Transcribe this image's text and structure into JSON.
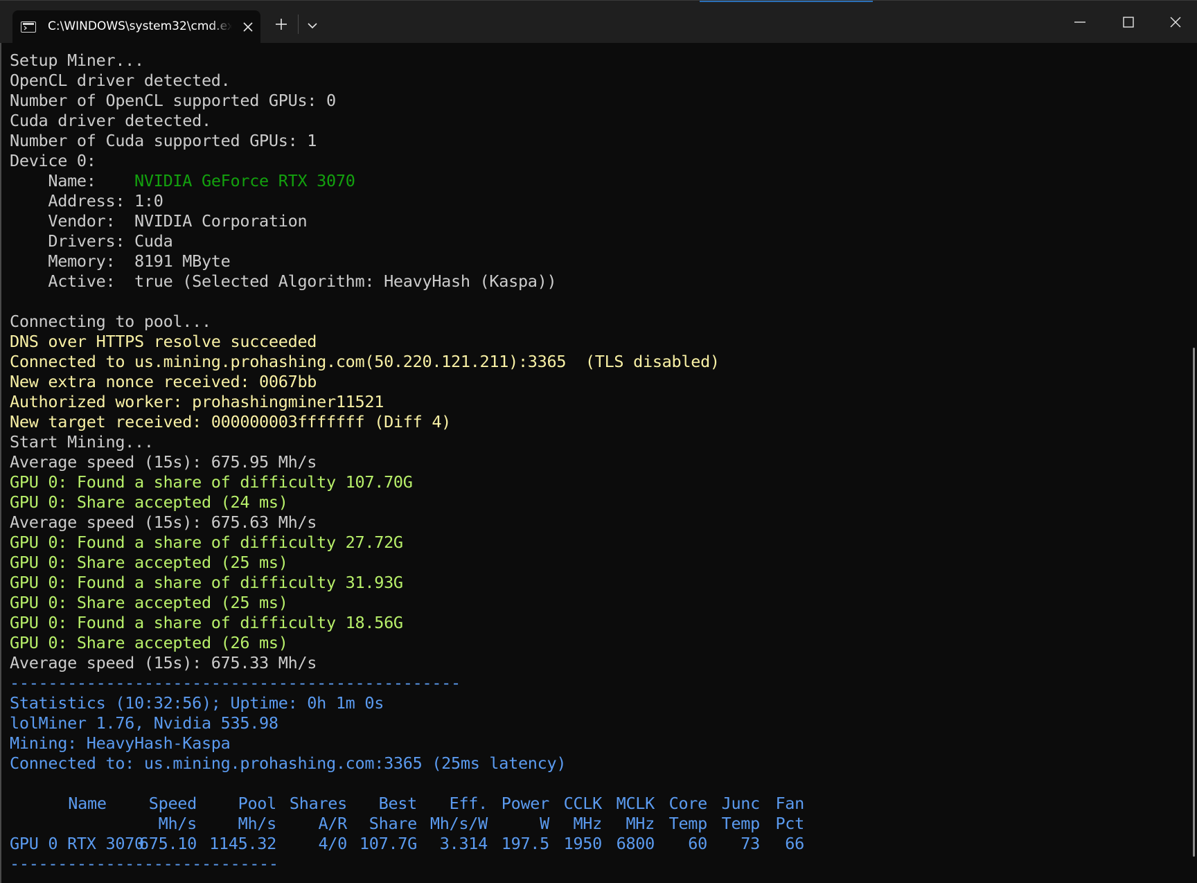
{
  "window": {
    "tab_title": "C:\\WINDOWS\\system32\\cmd.exe",
    "icons": {
      "tab": "terminal-icon",
      "tab_close": "close-icon",
      "new_tab": "plus-icon",
      "dropdown": "chevron-down-icon",
      "minimize": "minimize-icon",
      "maximize": "maximize-icon",
      "close": "close-icon"
    }
  },
  "colors": {
    "background": "#0c0c0c",
    "default_text": "#cccccc",
    "green": "#13a10e",
    "yellow": "#f9f1a5",
    "lime": "#b8f06a",
    "blue": "#5b9bf0"
  },
  "terminal": {
    "lines": [
      {
        "text": "Setup Miner...",
        "color": "default"
      },
      {
        "text": "OpenCL driver detected.",
        "color": "default"
      },
      {
        "text": "Number of OpenCL supported GPUs: 0",
        "color": "default"
      },
      {
        "text": "Cuda driver detected.",
        "color": "default"
      },
      {
        "text": "Number of Cuda supported GPUs: 1",
        "color": "default"
      },
      {
        "text": "Device 0:",
        "color": "default"
      },
      {
        "label": "    Name:    ",
        "value": "NVIDIA GeForce RTX 3070",
        "color": "default",
        "value_color": "green"
      },
      {
        "text": "    Address: 1:0",
        "color": "default"
      },
      {
        "text": "    Vendor:  NVIDIA Corporation",
        "color": "default"
      },
      {
        "text": "    Drivers: Cuda",
        "color": "default"
      },
      {
        "text": "    Memory:  8191 MByte",
        "color": "default"
      },
      {
        "text": "    Active:  true (Selected Algorithm: HeavyHash (Kaspa))",
        "color": "default"
      },
      {
        "text": "",
        "color": "default"
      },
      {
        "text": "Connecting to pool...",
        "color": "default"
      },
      {
        "text": "DNS over HTTPS resolve succeeded",
        "color": "yellow"
      },
      {
        "text": "Connected to us.mining.prohashing.com(50.220.121.211):3365  (TLS disabled)",
        "color": "yellow"
      },
      {
        "text": "New extra nonce received: 0067bb",
        "color": "yellow"
      },
      {
        "text": "Authorized worker: prohashingminer11521",
        "color": "yellow"
      },
      {
        "text": "New target received: 000000003fffffff (Diff 4)",
        "color": "yellow"
      },
      {
        "text": "Start Mining...",
        "color": "default"
      },
      {
        "text": "Average speed (15s): 675.95 Mh/s",
        "color": "default"
      },
      {
        "text": "GPU 0: Found a share of difficulty 107.70G",
        "color": "lime"
      },
      {
        "text": "GPU 0: Share accepted (24 ms)",
        "color": "lime"
      },
      {
        "text": "Average speed (15s): 675.63 Mh/s",
        "color": "default"
      },
      {
        "text": "GPU 0: Found a share of difficulty 27.72G",
        "color": "lime"
      },
      {
        "text": "GPU 0: Share accepted (25 ms)",
        "color": "lime"
      },
      {
        "text": "GPU 0: Found a share of difficulty 31.93G",
        "color": "lime"
      },
      {
        "text": "GPU 0: Share accepted (25 ms)",
        "color": "lime"
      },
      {
        "text": "GPU 0: Found a share of difficulty 18.56G",
        "color": "lime"
      },
      {
        "text": "GPU 0: Share accepted (26 ms)",
        "color": "lime"
      },
      {
        "text": "Average speed (15s): 675.33 Mh/s",
        "color": "default"
      },
      {
        "text": "-----------------------------------------------",
        "color": "blue"
      },
      {
        "text": "Statistics (10:32:56); Uptime: 0h 1m 0s",
        "color": "blue"
      },
      {
        "text": "lolMiner 1.76, Nvidia 535.98",
        "color": "blue"
      },
      {
        "text": "Mining: HeavyHash-Kaspa",
        "color": "blue"
      },
      {
        "text": "Connected to: us.mining.prohashing.com:3365 (25ms latency)",
        "color": "blue"
      },
      {
        "text": "",
        "color": "blue"
      }
    ],
    "stats_table": {
      "header_top": [
        "Name",
        "Speed",
        "Pool",
        "Shares",
        "Best",
        "Eff.",
        "Power",
        "CCLK",
        "MCLK",
        "Core",
        "Junc",
        "Fan"
      ],
      "header_bottom": [
        "",
        "Mh/s",
        "Mh/s",
        "A/R",
        "Share",
        "Mh/s/W",
        "W",
        "MHz",
        "MHz",
        "Temp",
        "Temp",
        "Pct"
      ],
      "rows": [
        [
          "GPU 0 RTX 3070",
          "675.10",
          "1145.32",
          "4/0",
          "107.7G",
          "3.314",
          "197.5",
          "1950",
          "6800",
          "60",
          "73",
          "66"
        ]
      ]
    },
    "footer_rule": "----------------------------"
  }
}
